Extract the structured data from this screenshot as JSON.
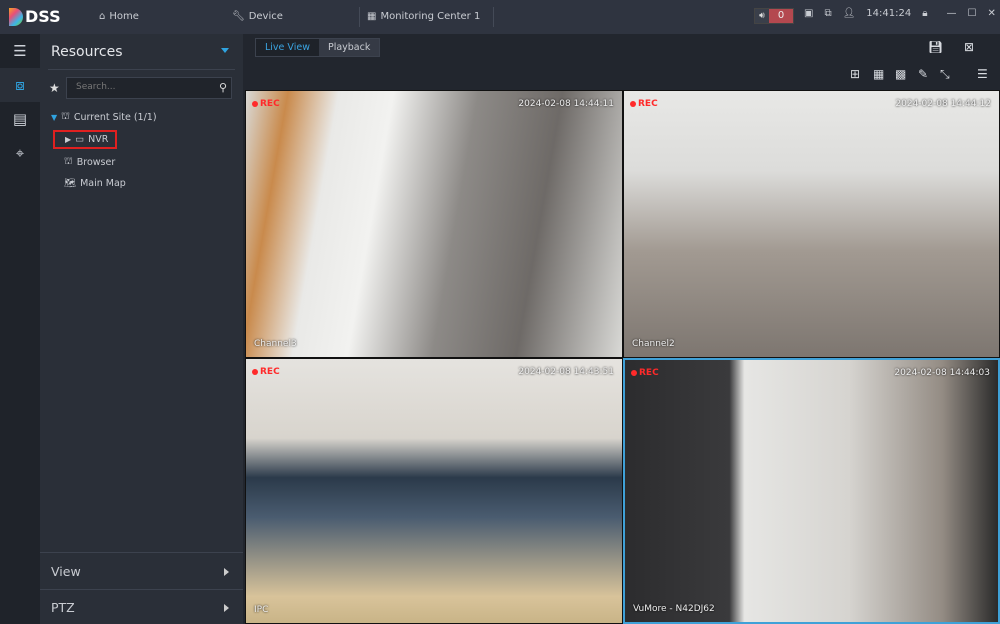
{
  "app": {
    "logo": "DSS"
  },
  "topnav": {
    "home": "Home",
    "device": "Device",
    "monitoring": "Monitoring Center 1"
  },
  "status": {
    "alarm_count": "0",
    "clock": "14:41:24"
  },
  "resources": {
    "title": "Resources",
    "search_placeholder": "Search...",
    "tree": {
      "site": "Current Site (1/1)",
      "nvr": "NVR",
      "browser": "Browser",
      "map": "Main Map"
    },
    "view": "View",
    "ptz": "PTZ"
  },
  "tabs": {
    "live": "Live View",
    "playback": "Playback"
  },
  "tiles": [
    {
      "rec": "REC",
      "timestamp": "2024-02-08 14:44:11",
      "label": "Channel3"
    },
    {
      "rec": "REC",
      "timestamp": "2024-02-08 14:44:12",
      "label": "Channel2"
    },
    {
      "rec": "REC",
      "timestamp": "2024-02-08 14:43:51",
      "label": "IPC"
    },
    {
      "rec": "REC",
      "timestamp": "2024-02-08 14:44:03",
      "label": "VuMore - N42DJ62"
    }
  ]
}
